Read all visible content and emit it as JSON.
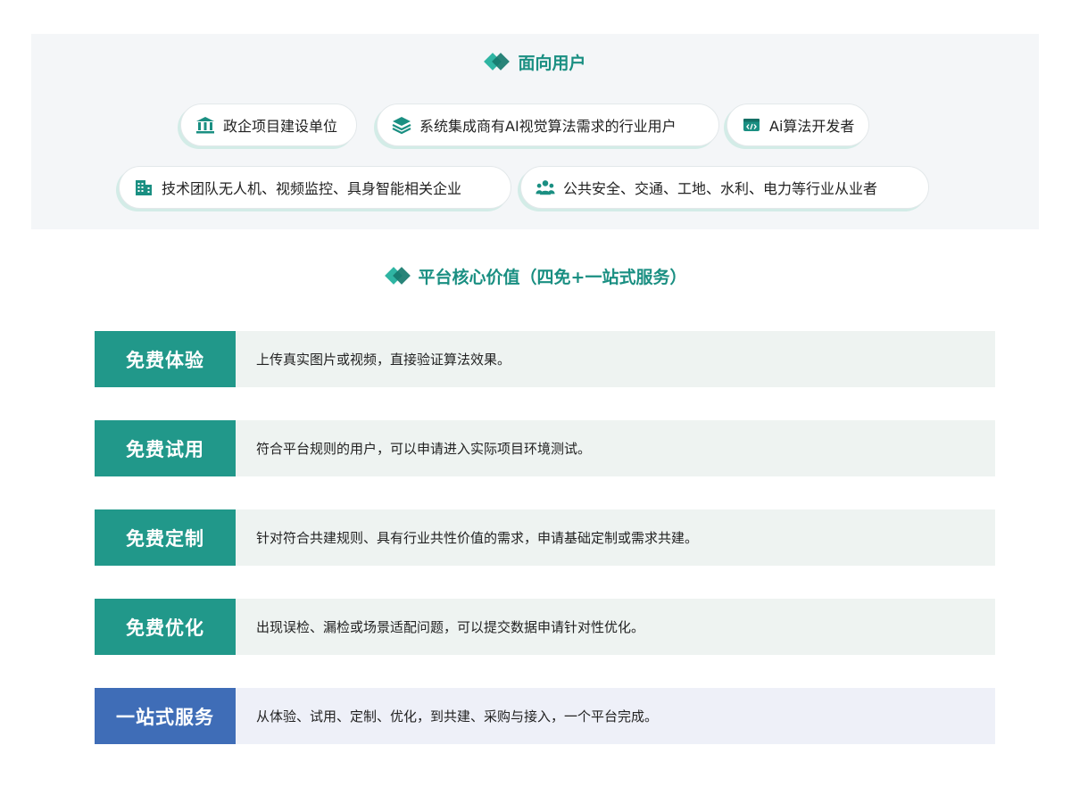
{
  "audience": {
    "title": "面向用户",
    "items": [
      {
        "label": "政企项目建设单位",
        "icon": "bank-icon"
      },
      {
        "label": "系统集成商有AI视觉算法需求的行业用户",
        "icon": "layers-icon"
      },
      {
        "label": "Ai算法开发者",
        "icon": "code-window-icon"
      },
      {
        "label": "技术团队无人机、视频监控、具身智能相关企业",
        "icon": "building-icon"
      },
      {
        "label": "公共安全、交通、工地、水利、电力等行业从业者",
        "icon": "group-icon"
      }
    ]
  },
  "values": {
    "title": "平台核心价值（四免+一站式服务）",
    "rows": [
      {
        "label": "免费体验",
        "desc": "上传真实图片或视频，直接验证算法效果。"
      },
      {
        "label": "免费试用",
        "desc": "符合平台规则的用户，可以申请进入实际项目环境测试。"
      },
      {
        "label": "免费定制",
        "desc": "针对符合共建规则、具有行业共性价值的需求，申请基础定制或需求共建。"
      },
      {
        "label": "免费优化",
        "desc": "出现误检、漏检或场景适配问题，可以提交数据申请针对性优化。"
      },
      {
        "label": "一站式服务",
        "desc": "从体验、试用、定制、优化，到共建、采购与接入，一个平台完成。"
      }
    ]
  },
  "colors": {
    "teal": "#1a8f82",
    "teal_label": "#21988a",
    "blue_label": "#3f6db7",
    "row_bg_green": "#eef3f1",
    "row_bg_blue": "#eef0f8",
    "panel_bg": "#f4f6f8"
  }
}
